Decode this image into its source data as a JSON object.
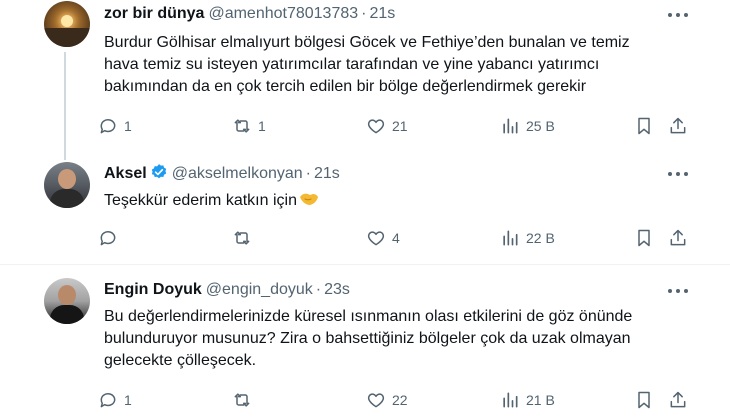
{
  "tweets": [
    {
      "name": "zor bir dünya",
      "handle": "@amenhot78013783",
      "time": "21s",
      "lines": [
        "Burdur Gölhisar elmalıyurt bölgesi Göcek ve Fethiye’den bunalan ve temiz",
        "hava temiz su isteyen yatırımcılar tarafından ve yine yabancı yatırımcı",
        "bakımından da en çok tercih edilen bir bölge değerlendirmek gerekir"
      ],
      "replies": "1",
      "retweets": "1",
      "likes": "21",
      "views": "25 B",
      "verified": false
    },
    {
      "name": "Aksel",
      "handle": "@akselmelkonyan",
      "time": "21s",
      "lines": [
        "Teşekkür ederim katkın için"
      ],
      "replies": "",
      "retweets": "",
      "likes": "4",
      "views": "22 B",
      "verified": true
    },
    {
      "name": "Engin Doyuk",
      "handle": "@engin_doyuk",
      "time": "23s",
      "lines": [
        "Bu değerlendirmelerinizde küresel ısınmanın olası etkilerini de göz önünde",
        "bulunduruyor musunuz? Zira o bahsettiğiniz bölgeler çok da uzak olmayan",
        "gelecekte çölleşecek."
      ],
      "replies": "1",
      "retweets": "",
      "likes": "22",
      "views": "21 B",
      "verified": false
    }
  ],
  "icons": {
    "reply": "reply-icon",
    "retweet": "retweet-icon",
    "like": "heart-icon",
    "views": "views-icon",
    "bookmark": "bookmark-icon",
    "share": "share-icon",
    "verified": "verified-badge-icon",
    "emoji": "handshake-emoji"
  },
  "colors": {
    "text": "#0f1419",
    "muted": "#536471",
    "verified": "#1d9bf0",
    "divider": "#eff3f4"
  }
}
